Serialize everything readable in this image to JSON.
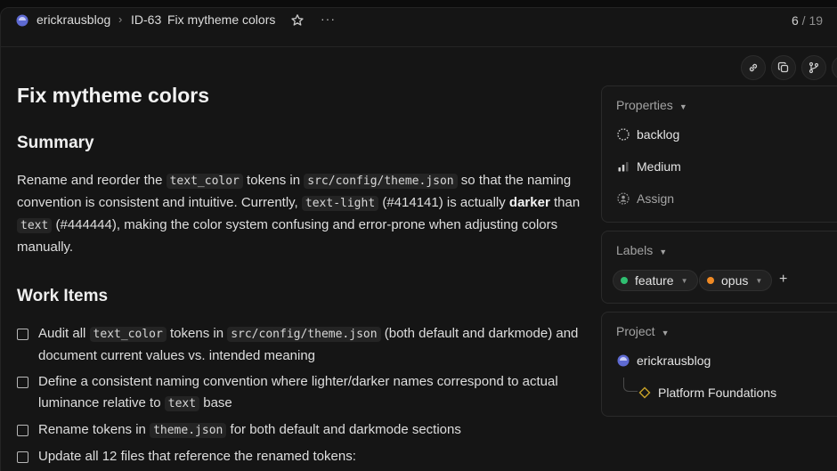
{
  "breadcrumb": {
    "team": "erickrausblog",
    "separator": "›",
    "issue_id": "ID-63",
    "issue_title": "Fix mytheme colors",
    "more": "···"
  },
  "pager": {
    "current": "6",
    "separator": " / ",
    "total": "19"
  },
  "issue": {
    "title": "Fix mytheme colors",
    "summary_heading": "Summary",
    "summary": {
      "t1": "Rename and reorder the ",
      "c1": "text_color",
      "t2": " tokens in ",
      "c2": "src/config/theme.json",
      "t3": " so that the naming convention is consistent and intuitive. Currently, ",
      "c3": "text-light",
      "t4": " (#414141) is actually ",
      "b1": "darker",
      "t5": " than ",
      "c4": "text",
      "t6": " (#444444), making the color system confusing and error-prone when adjusting colors manually."
    },
    "work_items_heading": "Work Items",
    "work_items": [
      {
        "t1": "Audit all ",
        "c1": "text_color",
        "t2": " tokens in ",
        "c2": "src/config/theme.json",
        "t3": " (both default and darkmode) and document current values vs. intended meaning"
      },
      {
        "t1": "Define a consistent naming convention where lighter/darker names correspond to actual luminance relative to ",
        "c1": "text",
        "t2": " base"
      },
      {
        "t1": "Rename tokens in ",
        "c1": "theme.json",
        "t2": " for both default and darkmode sections"
      },
      {
        "t1": "Update all 12 files that reference the renamed tokens:"
      }
    ]
  },
  "properties": {
    "heading": "Properties",
    "status": "backlog",
    "priority": "Medium",
    "assignee_placeholder": "Assign"
  },
  "labels": {
    "heading": "Labels",
    "items": [
      {
        "name": "feature",
        "color": "#2fbf71"
      },
      {
        "name": "opus",
        "color": "#f08a24"
      }
    ],
    "add": "+"
  },
  "project": {
    "heading": "Project",
    "team": "erickrausblog",
    "name": "Platform Foundations"
  },
  "colors": {
    "accent": "#5e6ad2",
    "project_diamond": "#c9a227"
  }
}
